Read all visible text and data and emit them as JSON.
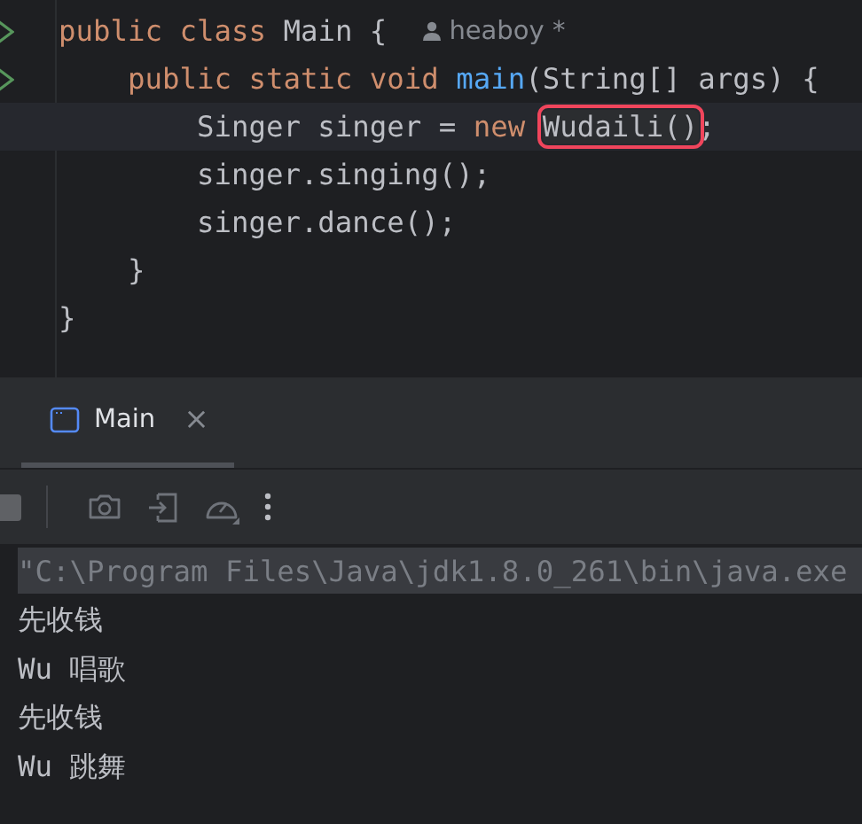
{
  "editor": {
    "lines": [
      {
        "run_marker": true,
        "current": false,
        "tokens": [
          {
            "kind": "keyword",
            "text": "public class "
          },
          {
            "kind": "plain",
            "text": "Main {"
          }
        ],
        "hint": "heaboy *"
      },
      {
        "run_marker": true,
        "current": false,
        "tokens": [
          {
            "kind": "keyword",
            "text": "    public static void "
          },
          {
            "kind": "method",
            "text": "main"
          },
          {
            "kind": "plain",
            "text": "(String[] args) {"
          }
        ]
      },
      {
        "run_marker": false,
        "current": true,
        "tokens": [
          {
            "kind": "plain",
            "text": "        Singer singer = "
          },
          {
            "kind": "keyword",
            "text": "new "
          },
          {
            "kind": "boxed",
            "text": "Wudaili()"
          },
          {
            "kind": "plain",
            "text": ";"
          }
        ]
      },
      {
        "run_marker": false,
        "current": false,
        "tokens": [
          {
            "kind": "plain",
            "text": "        singer.singing();"
          }
        ]
      },
      {
        "run_marker": false,
        "current": false,
        "tokens": [
          {
            "kind": "plain",
            "text": "        singer.dance();"
          }
        ]
      },
      {
        "run_marker": false,
        "current": false,
        "tokens": [
          {
            "kind": "plain",
            "text": "    }"
          }
        ]
      },
      {
        "run_marker": false,
        "current": false,
        "tokens": [
          {
            "kind": "plain",
            "text": "}"
          }
        ]
      }
    ]
  },
  "run_panel": {
    "tabs": [
      {
        "label": "Main",
        "selected": true,
        "close": "×"
      }
    ],
    "console": [
      {
        "kind": "command",
        "text": "\"C:\\Program Files\\Java\\jdk1.8.0_261\\bin\\java.exe"
      },
      {
        "kind": "output",
        "text": "先收钱"
      },
      {
        "kind": "output",
        "text": "Wu 唱歌"
      },
      {
        "kind": "output",
        "text": "先收钱"
      },
      {
        "kind": "output",
        "text": "Wu 跳舞"
      }
    ]
  }
}
